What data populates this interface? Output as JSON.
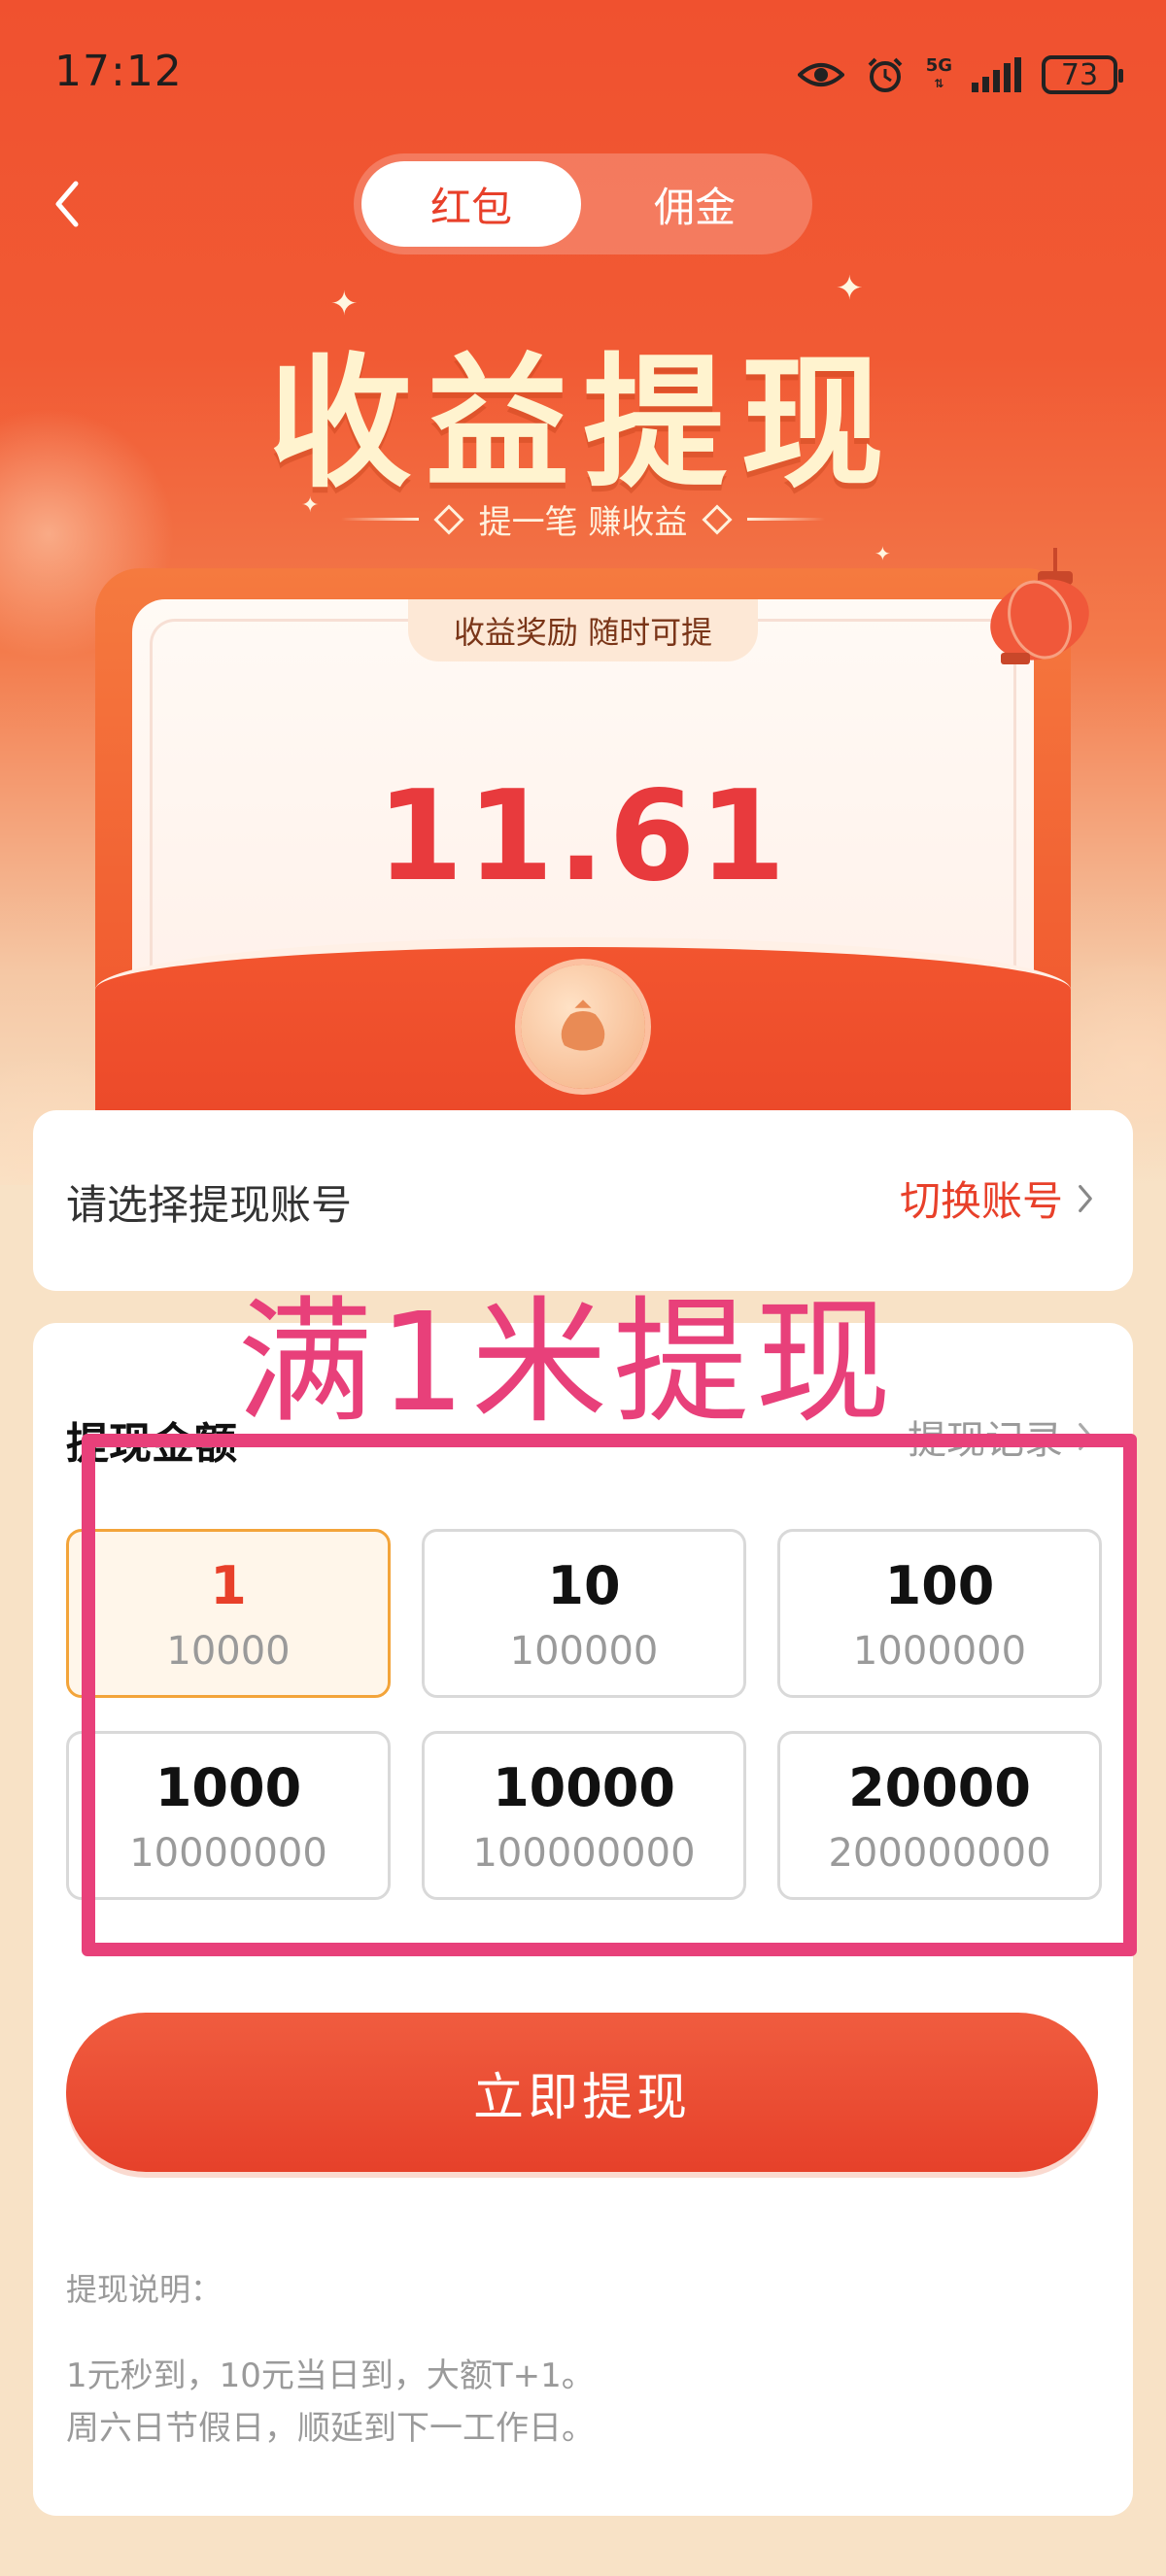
{
  "status_bar": {
    "time": "17:12",
    "network": "5G",
    "battery": "73"
  },
  "nav": {
    "tabs": [
      {
        "label": "红包",
        "active": true
      },
      {
        "label": "佣金",
        "active": false
      }
    ]
  },
  "hero": {
    "title": "收益提现",
    "subtitle": "提一笔 赚收益"
  },
  "envelope": {
    "notch_text": "收益奖励 随时可提",
    "balance": "11.61"
  },
  "account": {
    "label": "请选择提现账号",
    "switch_label": "切换账号"
  },
  "amount": {
    "title": "提现金额",
    "history_label": "提现记录",
    "options": [
      {
        "value": "1",
        "cost": "10000",
        "selected": true
      },
      {
        "value": "10",
        "cost": "100000",
        "selected": false
      },
      {
        "value": "100",
        "cost": "1000000",
        "selected": false
      },
      {
        "value": "1000",
        "cost": "10000000",
        "selected": false
      },
      {
        "value": "10000",
        "cost": "100000000",
        "selected": false
      },
      {
        "value": "20000",
        "cost": "200000000",
        "selected": false
      }
    ],
    "cta_label": "立即提现"
  },
  "notes": {
    "title": "提现说明：",
    "lines": [
      "1元秒到，10元当日到，大额T+1。",
      "周六日节假日，顺延到下一工作日。"
    ]
  },
  "annotation": {
    "text": "满1米提现"
  },
  "colors": {
    "primary_red": "#e8402a",
    "selected_border": "#f3a43a",
    "annotation": "#e8407a"
  }
}
